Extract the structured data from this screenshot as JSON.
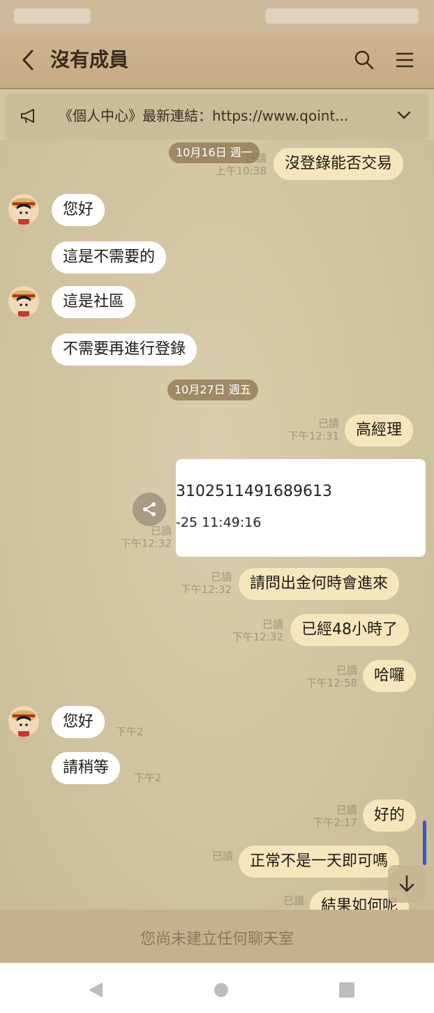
{
  "header": {
    "title": "沒有成員"
  },
  "notice": {
    "text": "《個人中心》最新連結：https://www.qoint..."
  },
  "chat": {
    "dates": [
      "10月16日 週一",
      "10月27日 週五"
    ],
    "messages": {
      "m1": {
        "text": "沒登錄能否交易",
        "status": "已讀",
        "time": "上午10:38"
      },
      "m2": {
        "text": "您好"
      },
      "m3": {
        "text": "這是不需要的"
      },
      "m4": {
        "text": "這是社區"
      },
      "m5": {
        "text": "不需要再進行登錄"
      },
      "m6": {
        "text": "高經理",
        "status": "已讀",
        "time": "下午12:31"
      },
      "m7": {
        "line1": "3102511491689613",
        "line2": "-25 11:49:16",
        "status": "已讀",
        "time": "下午12:32"
      },
      "m8": {
        "text": "請問出金何時會進來",
        "status": "已讀",
        "time": "下午12:32"
      },
      "m9": {
        "text": "已經48小時了",
        "status": "已讀",
        "time": "下午12:32"
      },
      "m10": {
        "text": "哈囉",
        "status": "已讀",
        "time": "下午12:58"
      },
      "m11": {
        "text": "您好",
        "time": "下午2"
      },
      "m12": {
        "text": "請稍等",
        "time": "下午2"
      },
      "m13": {
        "text": "好的",
        "status": "已讀",
        "time": "下午2:17"
      },
      "m14": {
        "text": "正常不是一天即可嗎",
        "status": "已讀"
      },
      "m15": {
        "text": "結果如何呢",
        "status": "已讀"
      }
    }
  },
  "input": {
    "placeholder": "您尚未建立任何聊天室"
  },
  "colors": {
    "accent_scroll": "#3c58c8",
    "outgoing_bubble": "#f5e6bd",
    "incoming_bubble": "#ffffff"
  },
  "icons": [
    "back-arrow-icon",
    "search-icon",
    "menu-icon",
    "megaphone-icon",
    "chevron-down-icon",
    "share-icon",
    "arrow-down-icon",
    "nav-back-icon",
    "nav-home-icon",
    "nav-recents-icon"
  ]
}
